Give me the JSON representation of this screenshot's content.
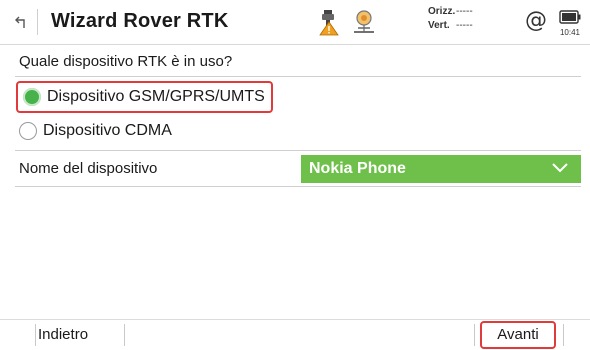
{
  "header": {
    "title": "Wizard Rover RTK",
    "orient_label": "Orizz.",
    "orient_value": "-----",
    "vert_label": "Vert.",
    "vert_value": "-----",
    "at_symbol": "@",
    "clock": "10:41",
    "icons": [
      "back-arrow-icon",
      "antenna-warning-icon",
      "rover-icon",
      "at-icon",
      "battery-icon"
    ]
  },
  "question": "Quale dispositivo RTK è in uso?",
  "options": [
    {
      "label": "Dispositivo GSM/GPRS/UMTS",
      "selected": true
    },
    {
      "label": "Dispositivo CDMA",
      "selected": false
    }
  ],
  "device": {
    "label": "Nome del dispositivo",
    "value": "Nokia Phone"
  },
  "footer": {
    "back_label": "Indietro",
    "next_label": "Avanti"
  },
  "colors": {
    "accent_green": "#6fc04a",
    "radio_green": "#47b24a",
    "highlight_red": "#e03a3a",
    "warning_orange": "#f0a020"
  }
}
